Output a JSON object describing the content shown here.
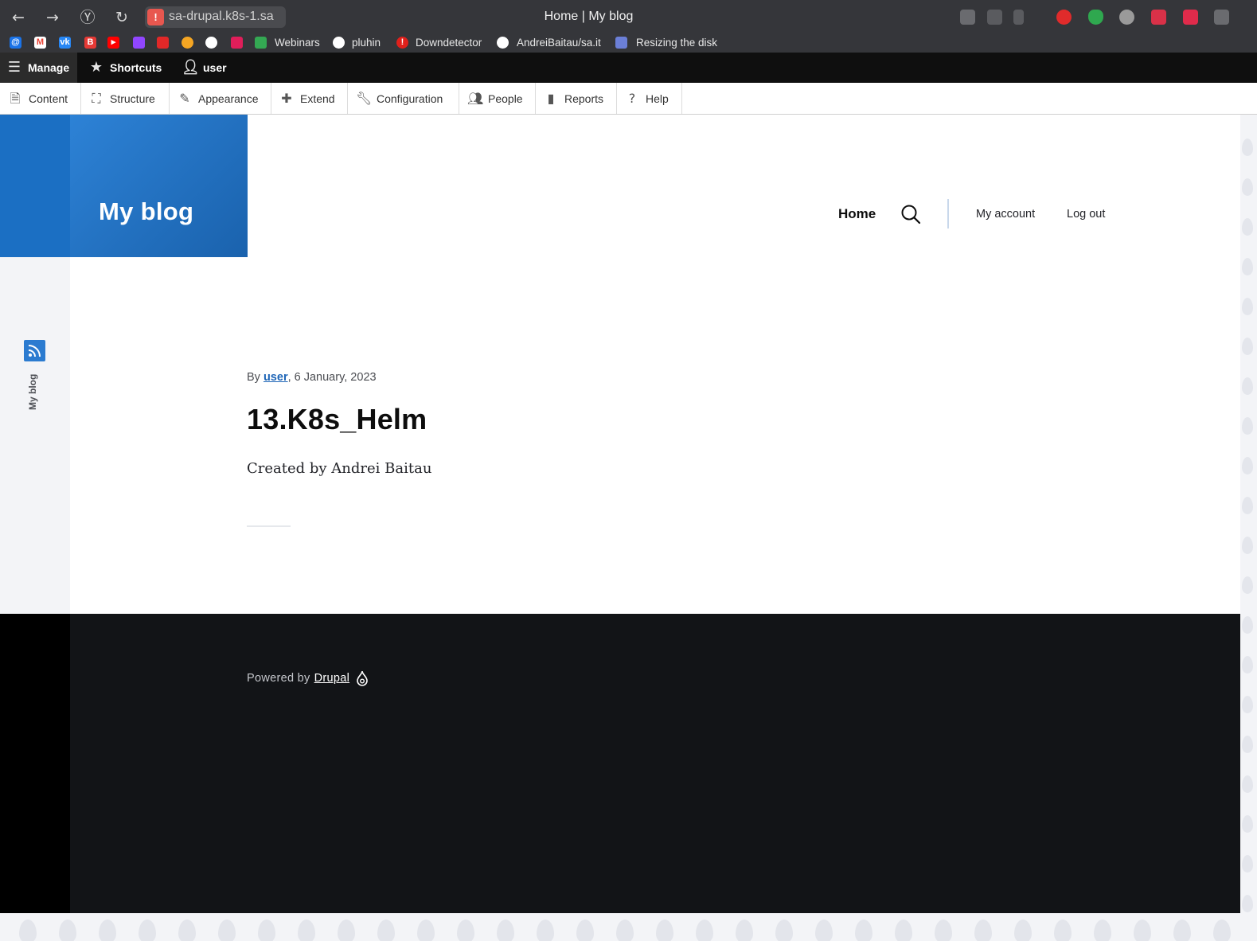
{
  "browser": {
    "url": "sa-drupal.k8s-1.sa",
    "tab_title": "Home | My blog",
    "url_warning": "!",
    "bookmarks": [
      {
        "label": "",
        "icon": "mail-icon",
        "color": "#1a73e8"
      },
      {
        "label": "",
        "icon": "gmail-icon",
        "color": "#ea4335"
      },
      {
        "label": "",
        "icon": "vk-icon",
        "color": "#2787f5"
      },
      {
        "label": "",
        "icon": "b-icon",
        "color": "#e53935"
      },
      {
        "label": "",
        "icon": "youtube-icon",
        "color": "#ff0000"
      },
      {
        "label": "",
        "icon": "twitch-icon",
        "color": "#9146ff"
      },
      {
        "label": "",
        "icon": "flipboard-icon",
        "color": "#e12828"
      },
      {
        "label": "",
        "icon": "power-icon",
        "color": "#f5a623"
      },
      {
        "label": "",
        "icon": "github-icon",
        "color": "#ffffff"
      },
      {
        "label": "",
        "icon": "slack-icon",
        "color": "#4a154b"
      },
      {
        "label": "Webinars",
        "icon": "drive-icon",
        "color": "#34a853"
      },
      {
        "label": "pluhin",
        "icon": "github-icon",
        "color": "#ffffff"
      },
      {
        "label": "Downdetector",
        "icon": "alert-icon",
        "color": "#e0201b"
      },
      {
        "label": "AndreiBaitau/sa.it",
        "icon": "github-icon",
        "color": "#ffffff"
      },
      {
        "label": "Resizing the disk",
        "icon": "doc-icon",
        "color": "#6b7fd7"
      }
    ]
  },
  "admin_toolbar": {
    "manage": "Manage",
    "shortcuts": "Shortcuts",
    "user": "user",
    "tray": [
      "Content",
      "Structure",
      "Appearance",
      "Extend",
      "Configuration",
      "People",
      "Reports",
      "Help"
    ]
  },
  "site": {
    "name": "My blog",
    "nav": {
      "home": "Home",
      "my_account": "My account",
      "log_out": "Log out"
    },
    "social_label": "My blog",
    "accent": "#2b7bd0"
  },
  "node": {
    "by": "By",
    "author": "user",
    "date": ", 6 January, 2023",
    "title": "13.K8s_Helm",
    "body": "Created by Andrei Baitau"
  },
  "footer": {
    "powered_by": "Powered by",
    "drupal": "Drupal"
  }
}
